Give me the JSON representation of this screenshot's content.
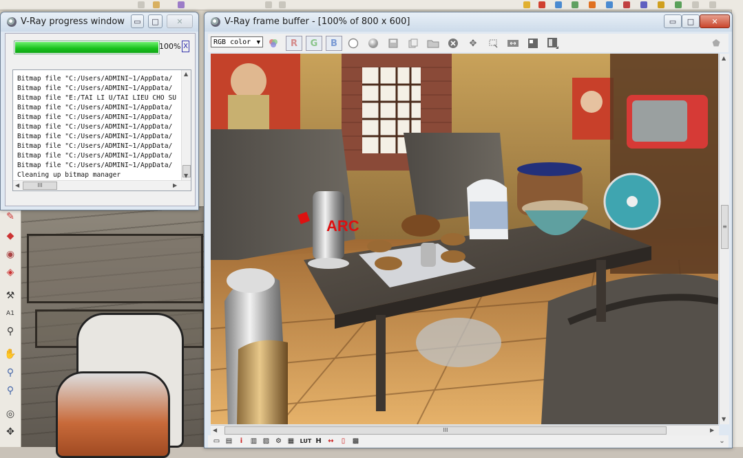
{
  "progress_window": {
    "title": "V-Ray progress window",
    "controls": {
      "minimize": "▭",
      "maximize": "□",
      "close": "✕"
    },
    "progress_percent": 100,
    "progress_label": "100%",
    "abort_label": "X",
    "log": [
      "Bitmap file \"C:/Users/ADMINI~1/AppData/",
      "Bitmap file \"C:/Users/ADMINI~1/AppData/",
      "Bitmap file \"E:/TAI LI U/TAI LIEU CHO SU",
      "Bitmap file \"C:/Users/ADMINI~1/AppData/",
      "Bitmap file \"C:/Users/ADMINI~1/AppData/",
      "Bitmap file \"C:/Users/ADMINI~1/AppData/",
      "Bitmap file \"C:/Users/ADMINI~1/AppData/",
      "Bitmap file \"C:/Users/ADMINI~1/AppData/",
      "Bitmap file \"C:/Users/ADMINI~1/AppData/",
      "Bitmap file \"C:/Users/ADMINI~1/AppData/",
      "Cleaning up bitmap manager"
    ],
    "scroll_grip": "III"
  },
  "frame_buffer": {
    "title": "V-Ray frame buffer - [100% of 800 x 600]",
    "controls": {
      "minimize": "▭",
      "maximize": "□",
      "close": "✕"
    },
    "channel": "RGB color",
    "channel_arrow": "▼",
    "buttons": {
      "r": "R",
      "g": "G",
      "b": "B"
    },
    "scroll_grip": "III",
    "watermark": "ARC",
    "bottom_tools": [
      "▭",
      "▤",
      "i",
      "▥",
      "▨",
      "⚙",
      "▦",
      "LUT",
      "H",
      "↔",
      "▯",
      "▩"
    ]
  },
  "colors": {
    "progress_fill": "#17c11b",
    "title_bar": "#cddbea",
    "close_button": "#c9452c",
    "rgb_r": "#d48a8a",
    "rgb_g": "#8ac48a",
    "rgb_b": "#7a9ad4"
  },
  "icons": {
    "progress_window": "vray-icon",
    "frame_buffer": "vray-icon",
    "circle_tool": "circle-icon",
    "sphere_tool": "sphere-icon",
    "save_tool": "save-icon",
    "copy_tool": "copy-icon",
    "open_tool": "folder-icon",
    "stop_tool": "stop-icon",
    "track_tool": "crosshair-icon",
    "region_tool": "region-icon",
    "compare_tool": "compare-icon",
    "correct_tool": "correction-icon",
    "lut_tool": "lut-icon"
  }
}
